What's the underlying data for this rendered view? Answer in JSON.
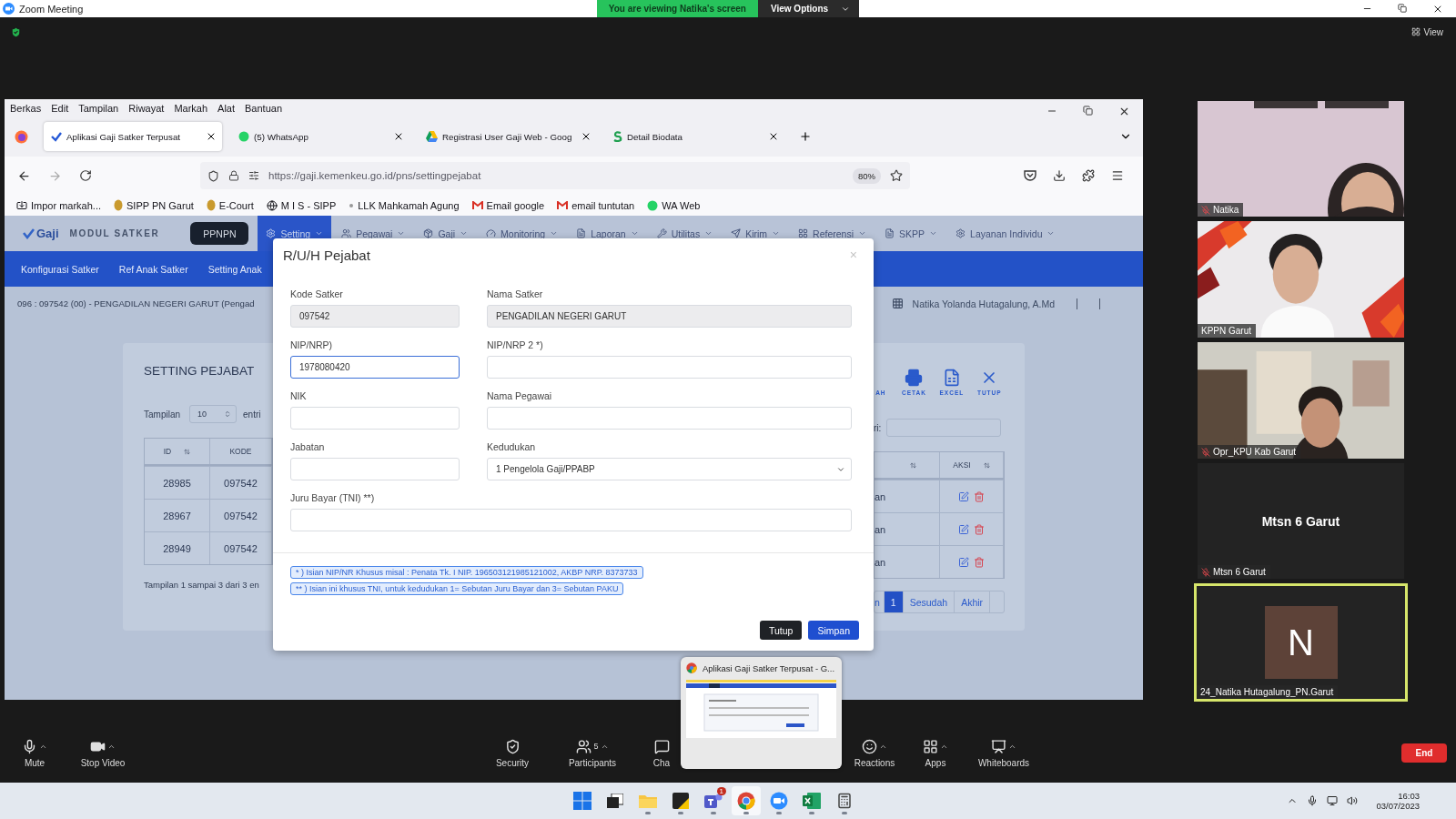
{
  "zoom_window": {
    "title": "Zoom Meeting",
    "share_banner": "You are viewing Natika's screen",
    "view_options": "View Options",
    "view_button": "View"
  },
  "browser": {
    "menu": [
      "Berkas",
      "Edit",
      "Tampilan",
      "Riwayat",
      "Markah",
      "Alat",
      "Bantuan"
    ],
    "tabs": [
      {
        "title": "Aplikasi Gaji Satker Terpusat",
        "selected": true
      },
      {
        "title": "(5) WhatsApp",
        "selected": false
      },
      {
        "title": "Registrasi User Gaji Web - Goog",
        "selected": false
      },
      {
        "title": "Detail Biodata",
        "selected": false
      }
    ],
    "url": "https://gaji.kemenkeu.go.id/pns/settingpejabat",
    "zoom": "80%",
    "bookmarks": [
      "Impor markah...",
      "SIPP PN Garut",
      "E-Court",
      "M I S - SIPP",
      "LLK Mahkamah Agung",
      "Email google",
      "email tuntutan",
      "WA Web"
    ]
  },
  "app": {
    "logo": "Gaji",
    "module": "MODUL SATKER",
    "ppnpn": "PPNPN",
    "nav": [
      {
        "label": "Setting",
        "selected": true
      },
      {
        "label": "Pegawai",
        "selected": false
      },
      {
        "label": "Gaji",
        "selected": false
      },
      {
        "label": "Monitoring",
        "selected": false
      },
      {
        "label": "Laporan",
        "selected": false
      },
      {
        "label": "Utilitas",
        "selected": false
      },
      {
        "label": "Kirim",
        "selected": false
      },
      {
        "label": "Referensi",
        "selected": false
      },
      {
        "label": "SKPP",
        "selected": false
      },
      {
        "label": "Layanan Individu",
        "selected": false
      }
    ],
    "subnav": [
      "Konfigurasi Satker",
      "Ref Anak Satker",
      "Setting Anak"
    ],
    "breadcrumb": "096 : 097542 (00) - PENGADILAN NEGERI GARUT (Pengad",
    "user": "Natika Yolanda Hutagalung, A.Md",
    "page_title": "SETTING PEJABAT",
    "length_label": "Tampilan",
    "length_value": "10",
    "length_suffix": "entri",
    "actions": [
      {
        "label": "AH"
      },
      {
        "label": "CETAK"
      },
      {
        "label": "EXCEL"
      },
      {
        "label": "TUTUP"
      }
    ],
    "search_label": "ri:",
    "table": {
      "columns": [
        "ID",
        "KODE"
      ],
      "action_column": "AKSI",
      "rows": [
        {
          "id": "28985",
          "kode": "097542",
          "column_3": "an"
        },
        {
          "id": "28967",
          "kode": "097542",
          "column_3": "an"
        },
        {
          "id": "28949",
          "kode": "097542",
          "column_3": "an"
        }
      ]
    },
    "info": "Tampilan 1 sampai 3 dari 3 en",
    "pagination": [
      {
        "label": "n",
        "selected": false
      },
      {
        "label": "1",
        "selected": true
      },
      {
        "label": "Sesudah",
        "selected": false
      },
      {
        "label": "Akhir",
        "selected": false
      }
    ]
  },
  "modal": {
    "title": "R/U/H Pejabat",
    "close": "×",
    "fields": [
      {
        "label": "Kode Satker",
        "kind": "readonly",
        "value": "097542"
      },
      {
        "label": "Nama Satker",
        "kind": "readonly",
        "value": "PENGADILAN NEGERI GARUT"
      },
      {
        "label": "NIP/NRP)",
        "kind": "text",
        "value": "1978080420",
        "focused": true
      },
      {
        "label": "NIP/NRP 2 *)",
        "kind": "text",
        "focused": false
      },
      {
        "label": "NIK",
        "kind": "text",
        "focused": false
      },
      {
        "label": "Nama Pegawai",
        "kind": "text",
        "focused": false
      },
      {
        "label": "Jabatan",
        "kind": "text",
        "focused": false
      },
      {
        "label": "Kedudukan",
        "kind": "select",
        "value": "1 Pengelola Gaji/PPABP"
      },
      {
        "label": "Juru Bayar (TNI) **)",
        "kind": "text",
        "focused": false
      }
    ],
    "notes": [
      "* ) Isian NIP/NR Khusus misal : Penata Tk. I NIP. 196503121985121002, AKBP NRP. 8373733",
      "** ) Isian ini khusus TNI, untuk kedudukan 1= Sebutan Juru Bayar dan 3= Sebutan PAKU"
    ],
    "buttons": [
      {
        "label": "Tutup",
        "kind": "secondary"
      },
      {
        "label": "Simpan",
        "kind": "primary"
      }
    ]
  },
  "participants": [
    {
      "kind": "video",
      "name": "Natika",
      "muted": true,
      "speaking": false
    },
    {
      "kind": "video",
      "name": "KPPN Garut",
      "muted": false,
      "speaking": false
    },
    {
      "kind": "video",
      "name": "Opr_KPU Kab Garut",
      "muted": true,
      "speaking": false
    },
    {
      "kind": "name",
      "display_name": "Mtsn 6 Garut",
      "name": "Mtsn 6 Garut",
      "muted": true,
      "speaking": false
    },
    {
      "kind": "avatar",
      "initial": "N",
      "name": "24_Natika Hutagalung_PN.Garut",
      "muted": false,
      "speaking": true
    }
  ],
  "toolbar": [
    {
      "label": "Mute",
      "caret": true
    },
    {
      "label": "Stop Video",
      "caret": true
    },
    {
      "label": "Security",
      "caret": false
    },
    {
      "label": "Participants",
      "count": "5",
      "caret": true
    },
    {
      "label": "Cha",
      "caret": false
    },
    {
      "label": "Reactions",
      "caret": true
    },
    {
      "label": "Apps",
      "caret": true
    },
    {
      "label": "Whiteboards",
      "caret": true
    }
  ],
  "end_button": "End",
  "preview": {
    "title": "Aplikasi Gaji Satker Terpusat - G..."
  },
  "taskbar": {
    "apps": [
      {
        "running": false,
        "active": false
      },
      {
        "running": false,
        "active": false
      },
      {
        "running": true,
        "active": false
      },
      {
        "running": true,
        "active": false
      },
      {
        "running": true,
        "active": false,
        "badge": "1"
      },
      {
        "running": true,
        "active": true
      },
      {
        "running": true,
        "active": false
      },
      {
        "running": true,
        "active": false
      },
      {
        "running": true,
        "active": false
      }
    ],
    "time": "16:03",
    "date": "03/07/2023"
  }
}
